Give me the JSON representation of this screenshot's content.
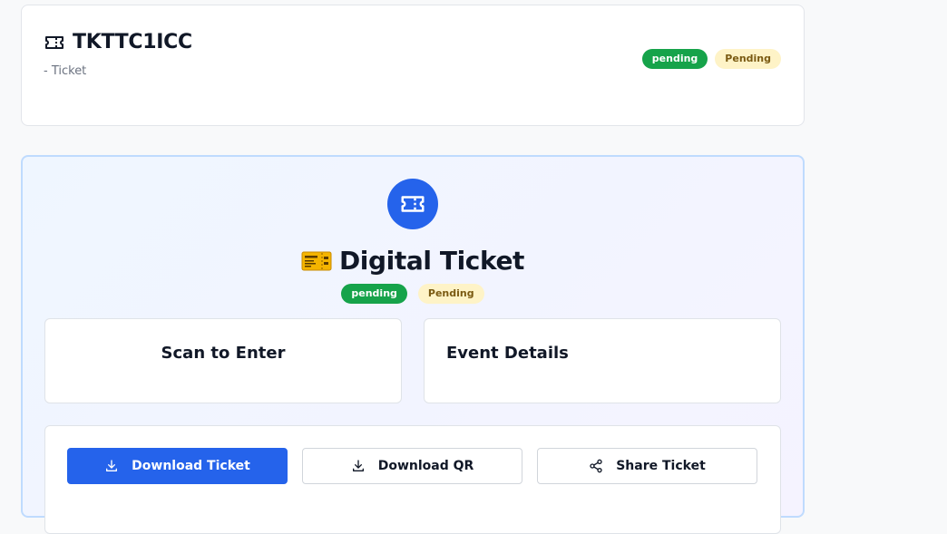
{
  "header": {
    "ticket_code": "TKTTC1ICC",
    "subtitle": "- Ticket",
    "status_badge": "pending",
    "payment_badge": "Pending"
  },
  "ticket_panel": {
    "title": "Digital Ticket",
    "status_badge": "pending",
    "payment_badge": "Pending",
    "scan_card_title": "Scan to Enter",
    "event_card_title": "Event Details"
  },
  "actions": {
    "download_ticket": "Download Ticket",
    "download_qr": "Download QR",
    "share_ticket": "Share Ticket"
  },
  "icons": {
    "header_icon": "ticket-icon",
    "panel_icon": "ticket-icon",
    "title_emoji": "ticket-emoji",
    "download_icon": "download-icon",
    "share_icon": "share-icon"
  },
  "colors": {
    "primary": "#2563eb",
    "success": "#16a34a",
    "warning_bg": "#fef3c7",
    "warning_text": "#7a5a12"
  }
}
